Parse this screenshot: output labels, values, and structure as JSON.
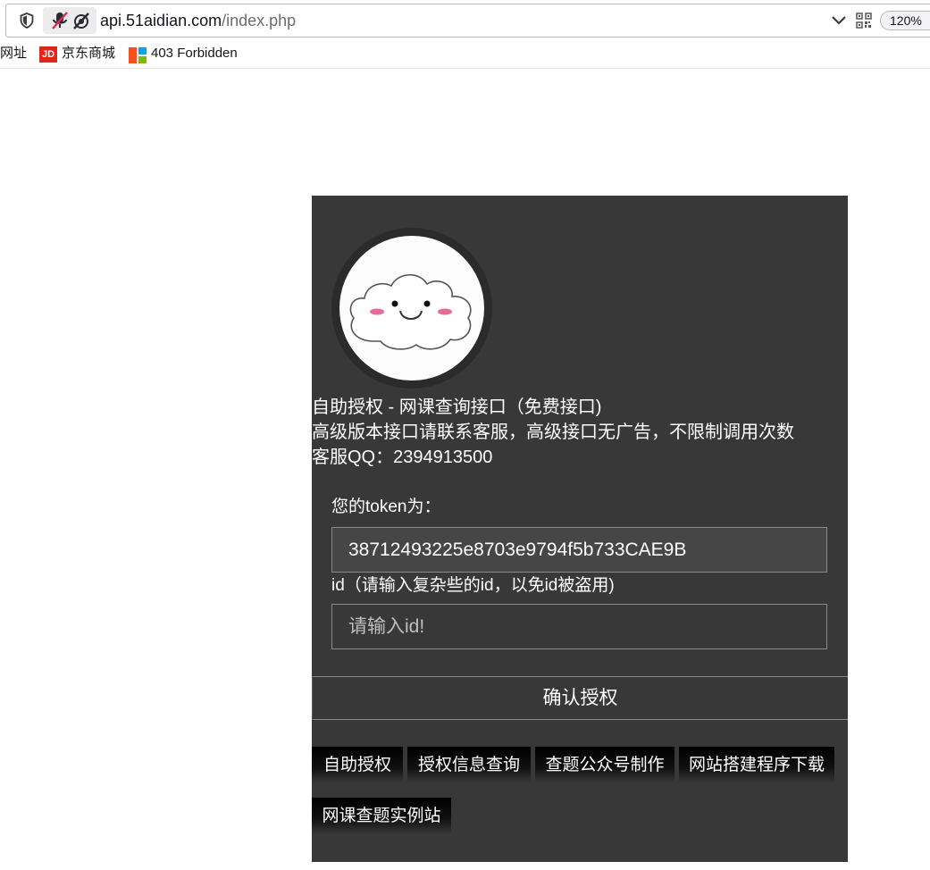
{
  "browser": {
    "url_host": "api.51aidian.com",
    "url_path": "/index.php",
    "zoom": "120%",
    "bookmarks": [
      "网址",
      "京东商城",
      "403 Forbidden"
    ],
    "jd_icon_text": "JD"
  },
  "header": {
    "title": "自助授权 - 网课查询接口（免费接口)",
    "notice": "高级版本接口请联系客服，高级接口无广告，不限制调用次数",
    "contact": "客服QQ：2394913500"
  },
  "form": {
    "token_label": "您的token为：",
    "token_value": "38712493225e8703e9794f5b733CAE9B",
    "id_label": "id（请输入复杂些的id，以免id被盗用)",
    "id_placeholder": "请输入id!",
    "confirm_label": "确认授权"
  },
  "nav": {
    "buttons": [
      "自助授权",
      "授权信息查询",
      "查题公众号制作",
      "网站搭建程序下载",
      "网课查题实例站"
    ]
  },
  "colors": {
    "panel": "#383838",
    "field_border": "#8a8a8a",
    "text": "#ffffff"
  }
}
